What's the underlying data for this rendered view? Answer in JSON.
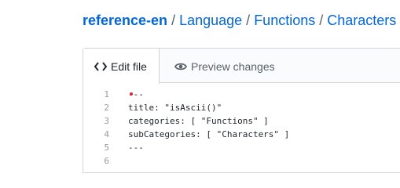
{
  "breadcrumb": {
    "repo": "reference-en",
    "items": [
      "Language",
      "Functions",
      "Characters"
    ],
    "separator": "/"
  },
  "tabs": {
    "edit_label": "Edit file",
    "preview_label": "Preview changes"
  },
  "code": {
    "lines": [
      {
        "num": "1",
        "text": "---"
      },
      {
        "num": "2",
        "text": "title: \"isAscii()\""
      },
      {
        "num": "3",
        "text": "categories: [ \"Functions\" ]"
      },
      {
        "num": "4",
        "text": "subCategories: [ \"Characters\" ]"
      },
      {
        "num": "5",
        "text": "---"
      },
      {
        "num": "6",
        "text": ""
      }
    ]
  },
  "colors": {
    "link": "#0366d6",
    "border": "#d1d5da",
    "cursor": "#e0212b"
  }
}
